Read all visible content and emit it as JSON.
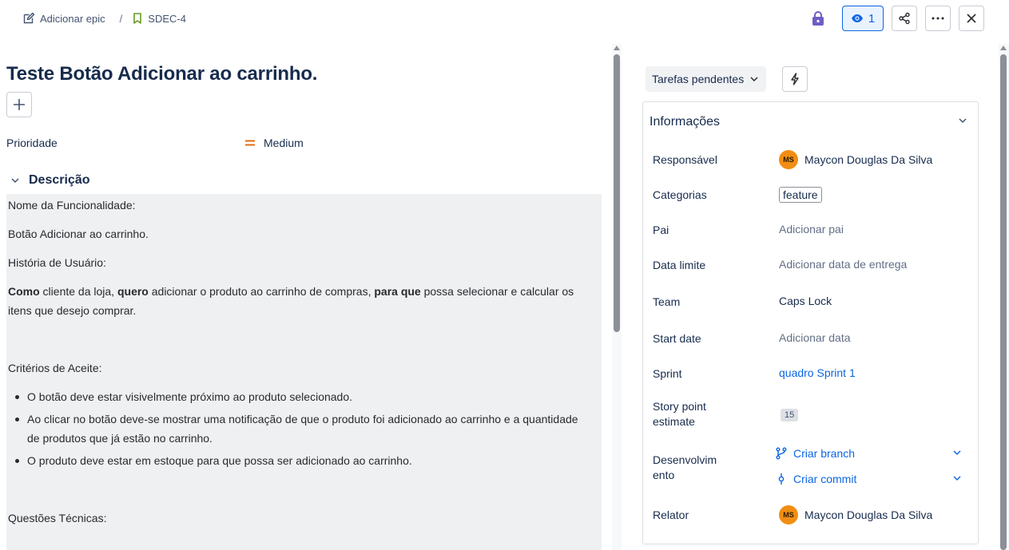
{
  "breadcrumb": {
    "epic_label": "Adicionar epic",
    "separator": "/",
    "issue_key": "SDEC-4"
  },
  "toolbar": {
    "watch_count": "1",
    "icons": [
      "lock-icon",
      "eye-icon",
      "share-icon",
      "more-icon",
      "close-icon"
    ]
  },
  "issue": {
    "title": "Teste Botão Adicionar ao carrinho.",
    "priority_label": "Prioridade",
    "priority_value": "Medium",
    "description_heading": "Descrição"
  },
  "description": {
    "p1": "Nome da Funcionalidade:",
    "p2": "Botão Adicionar ao carrinho.",
    "p3": "História de Usuário:",
    "story": {
      "b1": "Como",
      "t1": " cliente da loja, ",
      "b2": "quero",
      "t2": " adicionar o produto ao carrinho de compras, ",
      "b3": "para que",
      "t3": " possa selecionar e calcular os itens que desejo comprar."
    },
    "p5": "Critérios de Aceite:",
    "criteria": [
      "O botão deve estar visivelmente próximo ao produto selecionado.",
      "Ao clicar no botão deve-se mostrar uma notificação de que o produto foi adicionado ao carrinho e a quantidade de produtos que já estão no carrinho.",
      "O produto deve estar em estoque para que possa ser adicionado ao carrinho."
    ],
    "p6": "Questões Técnicas:"
  },
  "sidebar": {
    "status_button": "Tarefas pendentes",
    "info_title": "Informações",
    "fields": {
      "assignee_label": "Responsável",
      "assignee_initials": "MS",
      "assignee_name": "Maycon Douglas Da Silva",
      "categories_label": "Categorias",
      "category_tag": "feature",
      "parent_label": "Pai",
      "parent_value": "Adicionar pai",
      "due_label": "Data limite",
      "due_value": "Adicionar data de entrega",
      "team_label": "Team",
      "team_value": "Caps Lock",
      "start_label": "Start date",
      "start_value": "Adicionar data",
      "sprint_label": "Sprint",
      "sprint_value": "quadro Sprint 1",
      "story_points_label_1": "Story point",
      "story_points_label_2": "estimate",
      "story_points_value": "15",
      "dev_label_1": "Desenvolvim",
      "dev_label_2": "ento",
      "dev_branch": "Criar branch",
      "dev_commit": "Criar commit",
      "reporter_label": "Relator",
      "reporter_initials": "MS",
      "reporter_name": "Maycon Douglas Da Silva"
    }
  },
  "colors": {
    "link": "#0c66e4",
    "priority_medium": "#e56910",
    "avatar": "#f18d13",
    "lock": "#6e5dc6",
    "epic_bookmark": "#6a9a23"
  }
}
